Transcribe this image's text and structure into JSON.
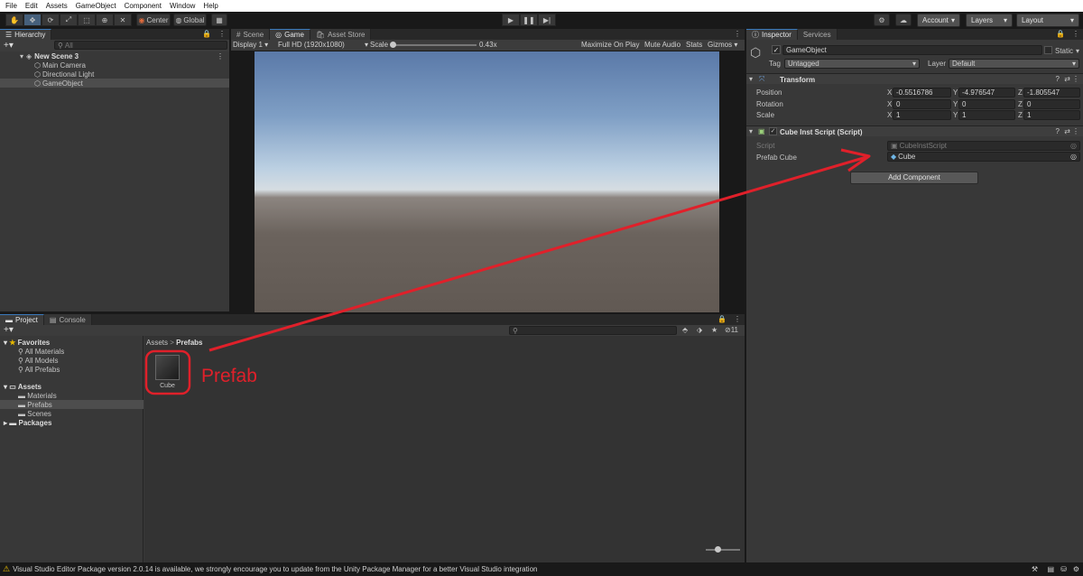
{
  "menu": [
    "File",
    "Edit",
    "Assets",
    "GameObject",
    "Component",
    "Window",
    "Help"
  ],
  "toolbar": {
    "pivot_label": "Center",
    "space_label": "Global",
    "account_label": "Account",
    "layers_label": "Layers",
    "layout_label": "Layout"
  },
  "hierarchy": {
    "tab_label": "Hierarchy",
    "search_placeholder": "All",
    "scene_name": "New Scene 3",
    "items": [
      "Main Camera",
      "Directional Light",
      "GameObject"
    ]
  },
  "game": {
    "tabs": [
      "Scene",
      "Game",
      "Asset Store"
    ],
    "display": "Display 1",
    "resolution": "Full HD (1920x1080)",
    "scale_label": "Scale",
    "scale_value": "0.43x",
    "scale_fraction": 0.0,
    "maximize": "Maximize On Play",
    "mute": "Mute Audio",
    "stats": "Stats",
    "gizmos": "Gizmos"
  },
  "project": {
    "tabs": [
      "Project",
      "Console"
    ],
    "favorites_label": "Favorites",
    "favorites": [
      "All Materials",
      "All Models",
      "All Prefabs"
    ],
    "assets_label": "Assets",
    "asset_folders": [
      "Materials",
      "Prefabs",
      "Scenes"
    ],
    "packages_label": "Packages",
    "breadcrumb_root": "Assets",
    "breadcrumb_current": "Prefabs",
    "hidden_count": "11",
    "asset_name": "Cube"
  },
  "inspector": {
    "tabs": [
      "Inspector",
      "Services"
    ],
    "object_name": "GameObject",
    "static_label": "Static",
    "tag_label": "Tag",
    "tag_value": "Untagged",
    "layer_label": "Layer",
    "layer_value": "Default",
    "transform": {
      "title": "Transform",
      "position_label": "Position",
      "rotation_label": "Rotation",
      "scale_label": "Scale",
      "position": [
        "-0.5516786",
        "-4.976547",
        "-1.805547"
      ],
      "rotation": [
        "0",
        "0",
        "0"
      ],
      "scale": [
        "1",
        "1",
        "1"
      ],
      "axes": [
        "X",
        "Y",
        "Z"
      ]
    },
    "script": {
      "title": "Cube Inst Script (Script)",
      "script_label": "Script",
      "script_value": "CubeInstScript",
      "prefab_label": "Prefab Cube",
      "prefab_value": "Cube"
    },
    "add_component": "Add Component"
  },
  "status": {
    "message": "Visual Studio Editor Package version 2.0.14 is available, we strongly encourage you to update from the Unity Package Manager for a better Visual Studio integration"
  },
  "annotation": {
    "label": "Prefab",
    "color": "#e0202a"
  }
}
